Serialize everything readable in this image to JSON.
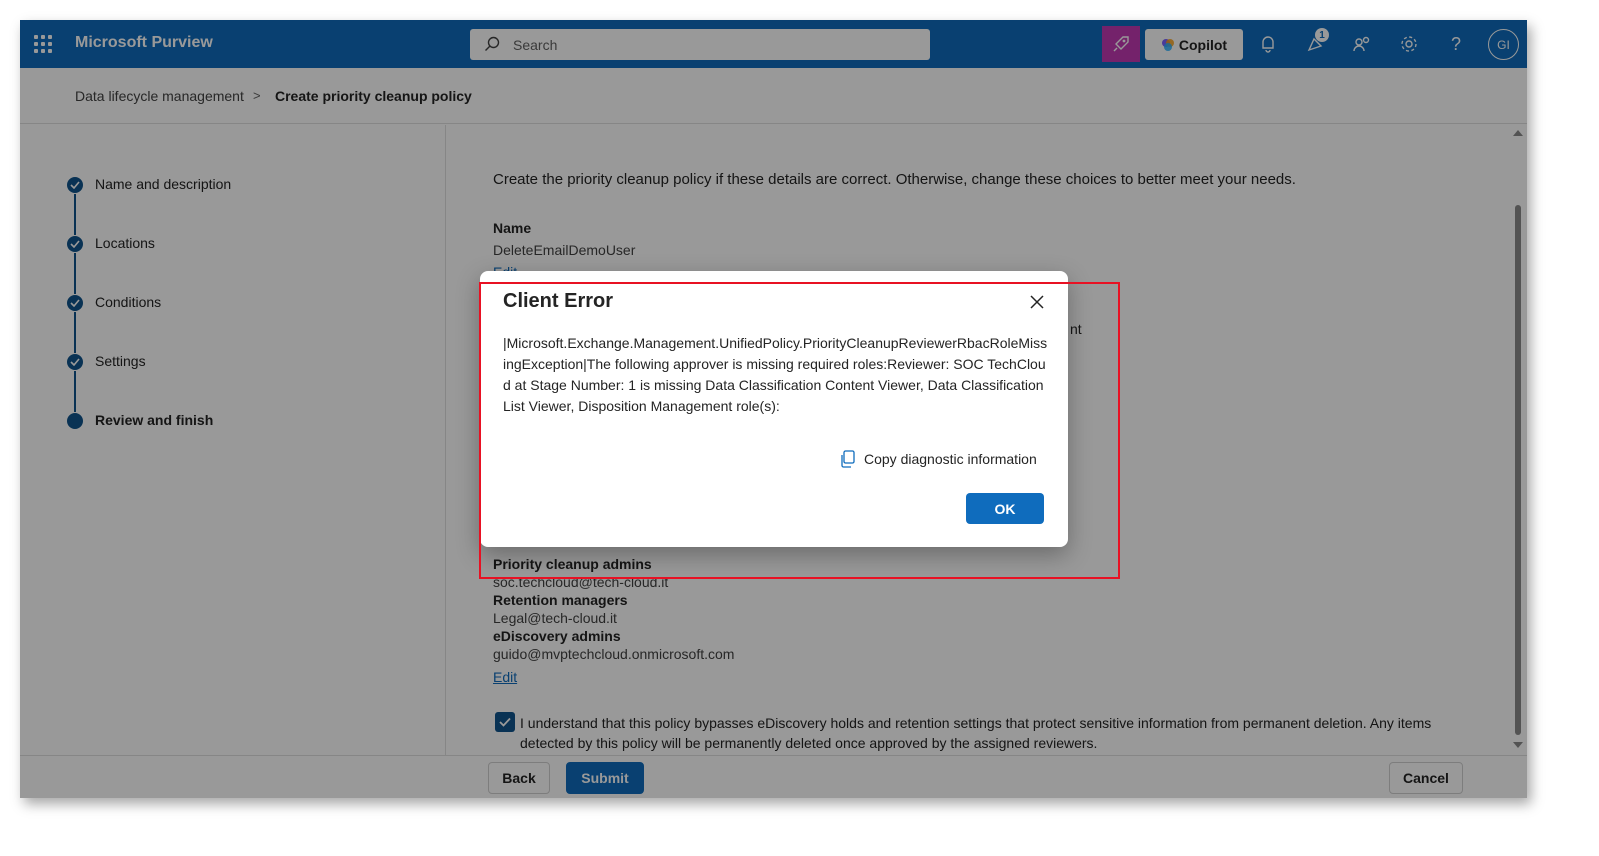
{
  "app": {
    "title": "Microsoft Purview"
  },
  "header": {
    "search_placeholder": "Search",
    "copilot_label": "Copilot",
    "notification_badge": "1",
    "avatar_initials": "GI",
    "help_label": "?"
  },
  "breadcrumb": {
    "parent": "Data lifecycle management",
    "separator": ">",
    "current": "Create priority cleanup policy"
  },
  "steps": [
    {
      "label": "Name and description",
      "state": "completed"
    },
    {
      "label": "Locations",
      "state": "completed"
    },
    {
      "label": "Conditions",
      "state": "completed"
    },
    {
      "label": "Settings",
      "state": "completed"
    },
    {
      "label": "Review and finish",
      "state": "current"
    }
  ],
  "review": {
    "intro": "Create the priority cleanup policy if these details are correct. Otherwise, change these choices to better meet your needs.",
    "name_heading": "Name",
    "name_value": "DeleteEmailDemoUser",
    "edit_partial": "Edit",
    "hidden_fragment": "nt",
    "priority_admins_heading": "Priority cleanup admins",
    "priority_admins_value": "soc.techcloud@tech-cloud.it",
    "retention_managers_heading": "Retention managers",
    "retention_managers_value": "Legal@tech-cloud.it",
    "ediscovery_admins_heading": "eDiscovery admins",
    "ediscovery_admins_value": "guido@mvptechcloud.onmicrosoft.com",
    "edit_link": "Edit",
    "acknowledge_text": "I understand that this policy bypasses eDiscovery holds and retention settings that protect sensitive information from permanent deletion. Any items detected by this policy will be permanently deleted once approved by the assigned reviewers.",
    "acknowledge_checked": true
  },
  "footer": {
    "back_label": "Back",
    "submit_label": "Submit",
    "cancel_label": "Cancel"
  },
  "dialog": {
    "title": "Client Error",
    "message": "|Microsoft.Exchange.Management.UnifiedPolicy.PriorityCleanupReviewerRbacRoleMissingException|The following approver is missing required roles:Reviewer: SOC TechCloud at Stage Number: 1 is missing Data Classification Content Viewer, Data Classification List Viewer, Disposition Management role(s):",
    "copy_diag_label": "Copy diagnostic information",
    "ok_label": "OK"
  },
  "colors": {
    "brand": "#0f6cbd",
    "step_complete": "#0f548c",
    "copilot_launch": "#c239b3",
    "highlight_border": "#e81123"
  }
}
